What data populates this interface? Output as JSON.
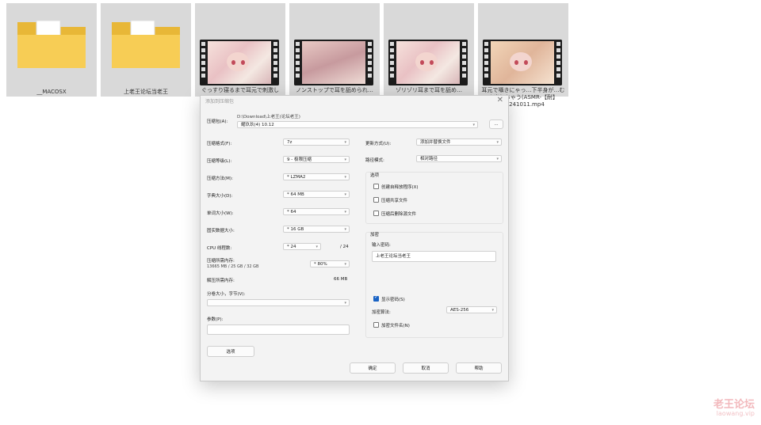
{
  "desktop": {
    "tiles": [
      {
        "kind": "folder",
        "label": "__MACOSX"
      },
      {
        "kind": "folder",
        "label": "上老王论坛当老王"
      },
      {
        "kind": "video",
        "label": "ぐっすり寝るまで耳元で刺激して…"
      },
      {
        "kind": "video",
        "label": "ノンストップで耳を舐められ…"
      },
      {
        "kind": "video",
        "label": "ゾリゾリ耳まで耳を舐め…"
      },
      {
        "kind": "video",
        "label": "耳元で囁きにゃっ…下半身が…むき出しちゃう(ASMR-【耐】20241011.mp4"
      }
    ]
  },
  "dialog": {
    "title": "添加到压缩包",
    "archive_label": "压缩包(A):",
    "archive_path": "D:\\Download\\上老王(论坛老王)",
    "archive_name": "耀玖玖(4) 10.12",
    "browse": "...",
    "left": {
      "format_label": "压缩格式(F):",
      "format_value": "7z",
      "level_label": "压缩等级(L):",
      "level_value": "9 - 极限压缩",
      "method_label": "压缩方法(M):",
      "method_value": "* LZMA2",
      "dict_label": "字典大小(D):",
      "dict_value": "* 64 MB",
      "word_label": "单词大小(W):",
      "word_value": "* 64",
      "solid_label": "固实数据大小:",
      "solid_value": "* 16 GB",
      "cpu_label": "CPU 线程数:",
      "cpu_value": "* 24",
      "cpu_total": "/ 24",
      "mem_label": "压缩所需内存:",
      "mem_sub": "13665 MB / 25 GB / 32 GB",
      "mem_value": "* 80%",
      "unmem_label": "解压所需内存:",
      "unmem_value": "66 MB",
      "split_label": "分卷大小，字节(V):",
      "split_value": "",
      "params_label": "参数(P):",
      "params_value": "",
      "options_btn": "选项"
    },
    "right": {
      "update_label": "更新方式(U):",
      "update_value": "添加并替换文件",
      "path_label": "路径模式:",
      "path_value": "相对路径",
      "options_group": "选项",
      "opt1": "创建自释放程序(X)",
      "opt1_checked": false,
      "opt2": "压缩共享文件",
      "opt2_checked": false,
      "opt3": "压缩后删除源文件",
      "opt3_checked": false,
      "enc_group": "加密",
      "pwd_label": "输入密码:",
      "pwd_value": "上老王论坛当老王",
      "show_pwd": "显示密码(S)",
      "show_pwd_checked": true,
      "enc_method_label": "加密算法:",
      "enc_method_value": "AES-256",
      "enc_names": "加密文件名(N)",
      "enc_names_checked": false
    },
    "buttons": {
      "ok": "确定",
      "cancel": "取消",
      "help": "帮助"
    }
  },
  "watermark": {
    "line1": "老王论坛",
    "line2": "laowang.vip"
  },
  "colors": {
    "accent": "#1a63c4",
    "folder": "#f5c542",
    "watermark": "#f2b8bc"
  }
}
